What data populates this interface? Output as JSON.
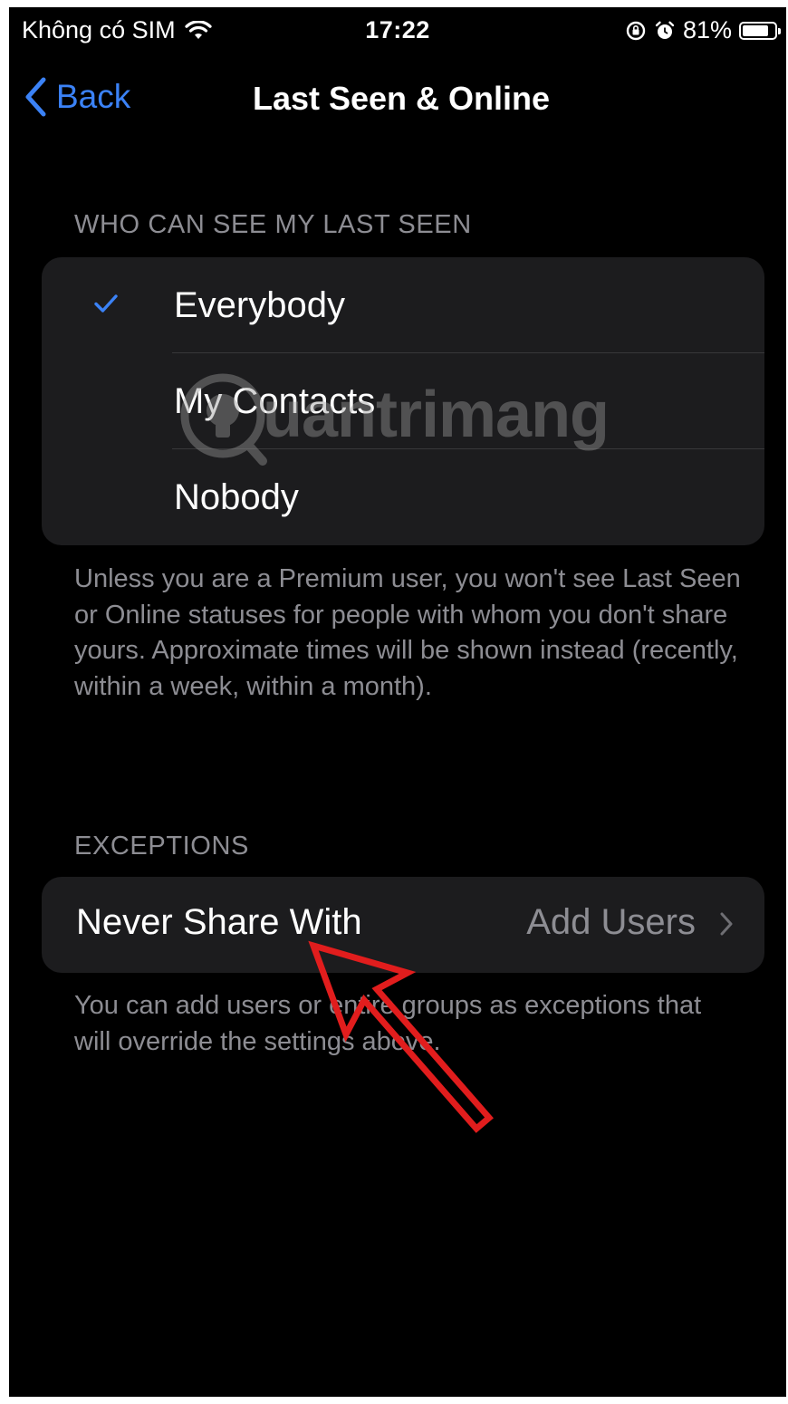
{
  "status_bar": {
    "carrier": "Không có SIM",
    "time": "17:22",
    "battery": "81%",
    "battery_level": 0.81
  },
  "nav": {
    "back_label": "Back",
    "title": "Last Seen & Online"
  },
  "last_seen_section": {
    "header": "WHO CAN SEE MY LAST SEEN",
    "options": [
      {
        "label": "Everybody",
        "selected": true
      },
      {
        "label": "My Contacts",
        "selected": false
      },
      {
        "label": "Nobody",
        "selected": false
      }
    ],
    "footer": "Unless you are a Premium user, you won't see Last Seen or Online statuses for people with whom you don't share yours. Approximate times will be shown instead (recently, within a week, within a month)."
  },
  "exceptions_section": {
    "header": "EXCEPTIONS",
    "row_label": "Never Share With",
    "row_value": "Add Users",
    "footer": "You can add users or entire groups as exceptions that will override the settings above."
  },
  "watermark": {
    "text": "uantrimang"
  },
  "colors": {
    "accent": "#3b82f6",
    "background": "#000000",
    "group_background": "#1c1c1e",
    "secondary_text": "#8d8d93",
    "annotation": "#e11d1d"
  },
  "icons": {
    "wifi": "wifi-icon",
    "orientation_lock": "orientation-lock-icon",
    "alarm": "alarm-icon",
    "battery": "battery-icon",
    "back": "chevron-left-icon",
    "check": "checkmark-icon",
    "chevron": "chevron-right-icon",
    "arrow": "red-arrow-annotation"
  }
}
